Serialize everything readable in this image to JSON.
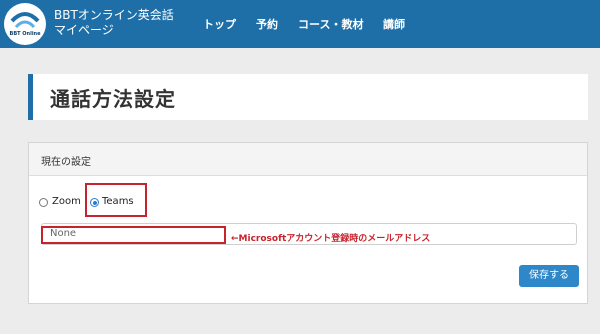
{
  "header": {
    "logo_text": "BBT Online",
    "title_line1": "BBTオンライン英会話",
    "title_line2": "マイページ",
    "nav": [
      "トップ",
      "予約",
      "コース・教材",
      "講師"
    ]
  },
  "page": {
    "title": "通話方法設定"
  },
  "settings": {
    "panel_title": "現在の設定",
    "options": [
      {
        "label": "Zoom",
        "checked": false
      },
      {
        "label": "Teams",
        "checked": true
      }
    ],
    "email_value": "None",
    "annotation": "←Microsoftアカウント登録時のメールアドレス",
    "save_label": "保存する"
  },
  "colors": {
    "header_bg": "#1e6fa8",
    "accent": "#1e6fa8",
    "button": "#2d87c9",
    "highlight_red": "#c8232c"
  }
}
